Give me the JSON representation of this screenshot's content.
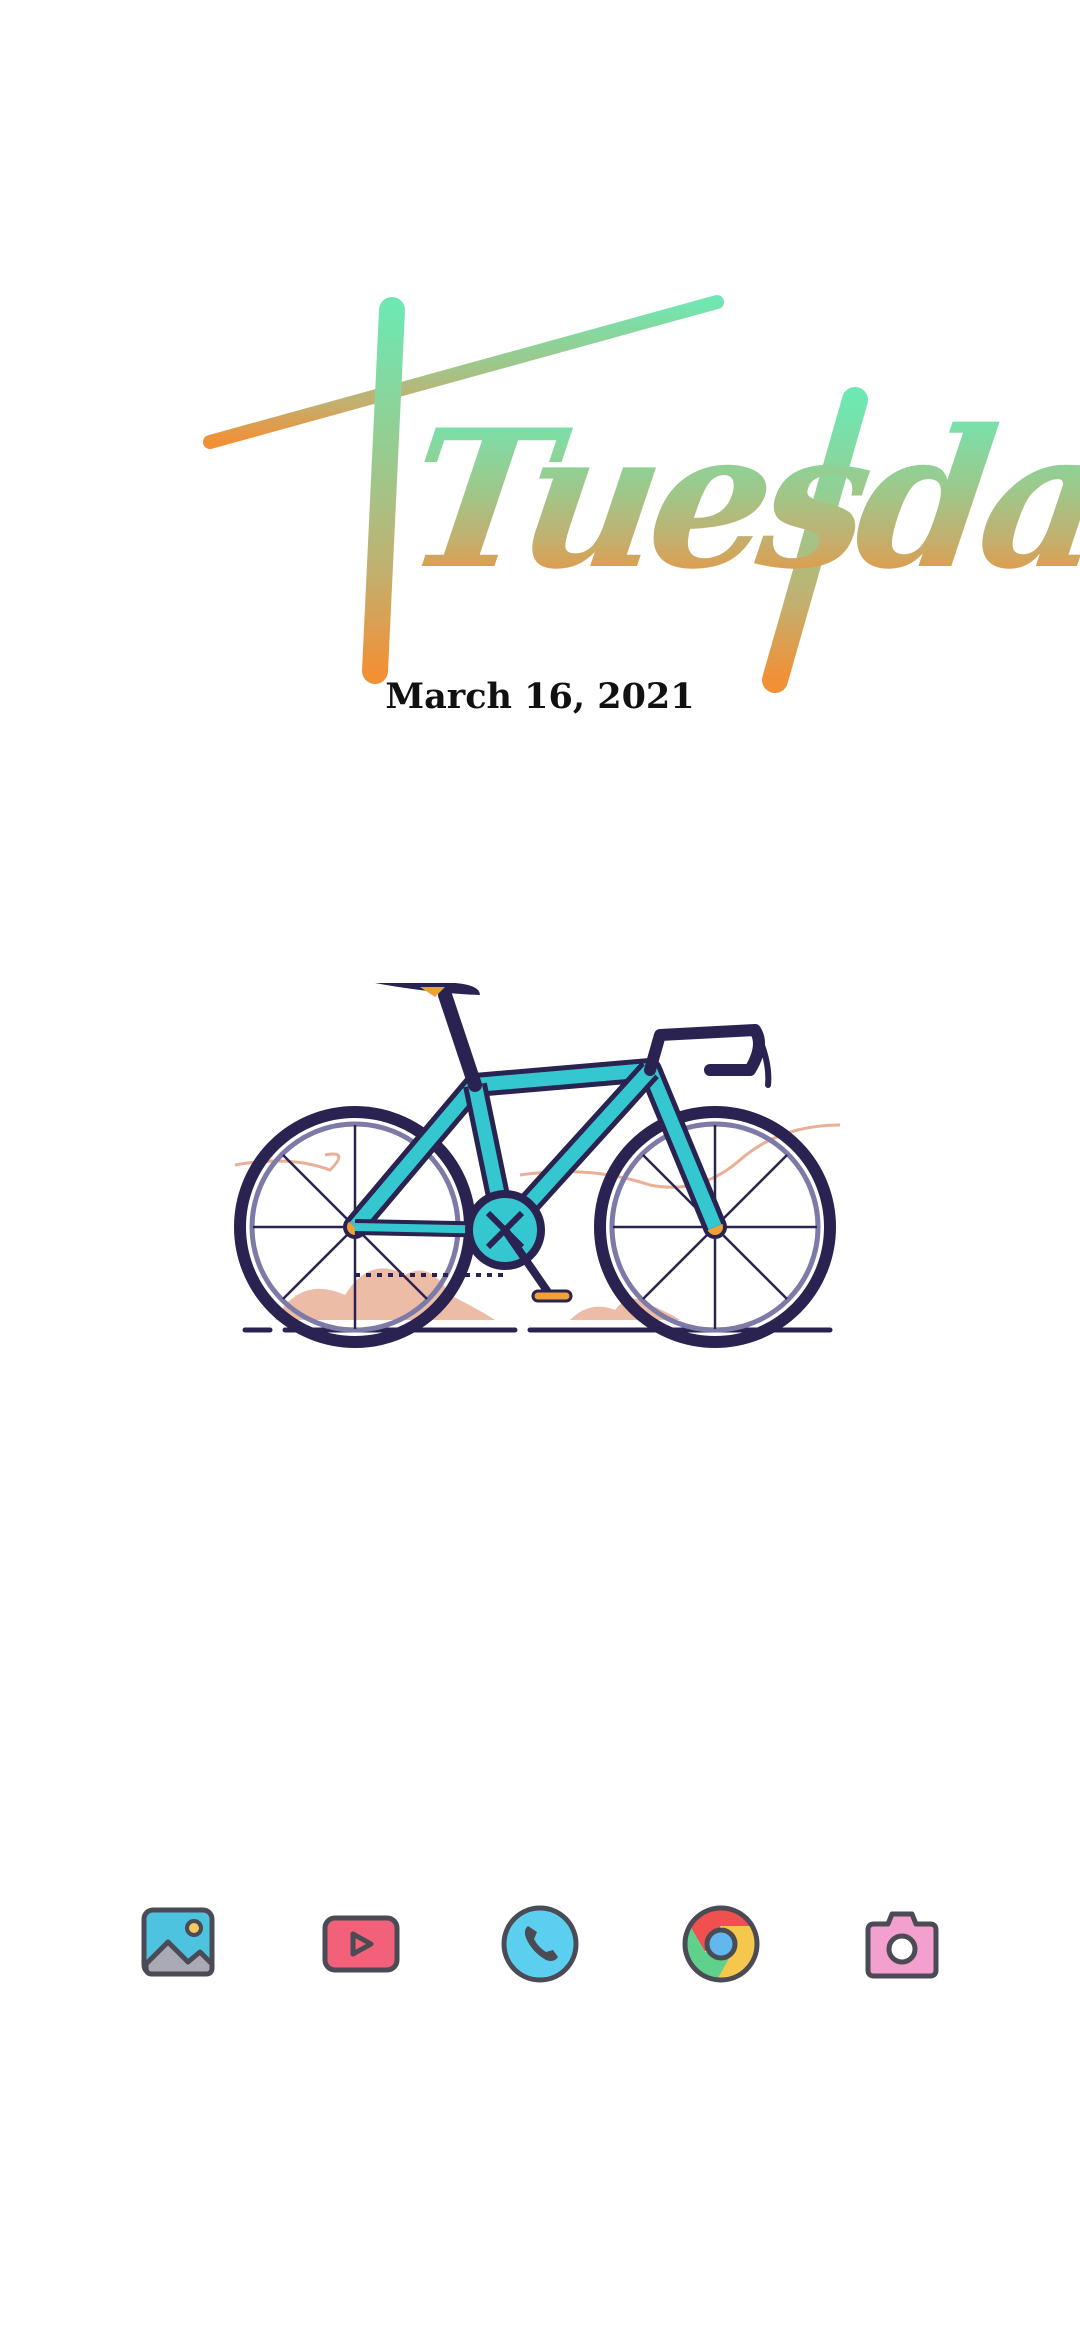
{
  "wallpaper": {
    "day_text": "Tuesday",
    "date_text": "March 16, 2021",
    "illustration": "road-bicycle"
  },
  "colors": {
    "background": "#ffffff",
    "gradient_top": "#6fe7b2",
    "gradient_bottom": "#f29035",
    "bike_frame": "#35c7cf",
    "bike_outline": "#2a2250",
    "accent_orange": "#f0a037",
    "sand": "#e9b097"
  },
  "dock": {
    "apps": [
      {
        "name": "Gallery",
        "icon": "gallery-icon",
        "color": "#4ec3e0"
      },
      {
        "name": "YouTube",
        "icon": "youtube-icon",
        "color": "#f2607a"
      },
      {
        "name": "Phone",
        "icon": "phone-icon",
        "color": "#5ccff0"
      },
      {
        "name": "Chrome",
        "icon": "chrome-icon",
        "color": "#f0504f"
      },
      {
        "name": "Camera",
        "icon": "camera-icon",
        "color": "#f3a0cf"
      }
    ]
  }
}
